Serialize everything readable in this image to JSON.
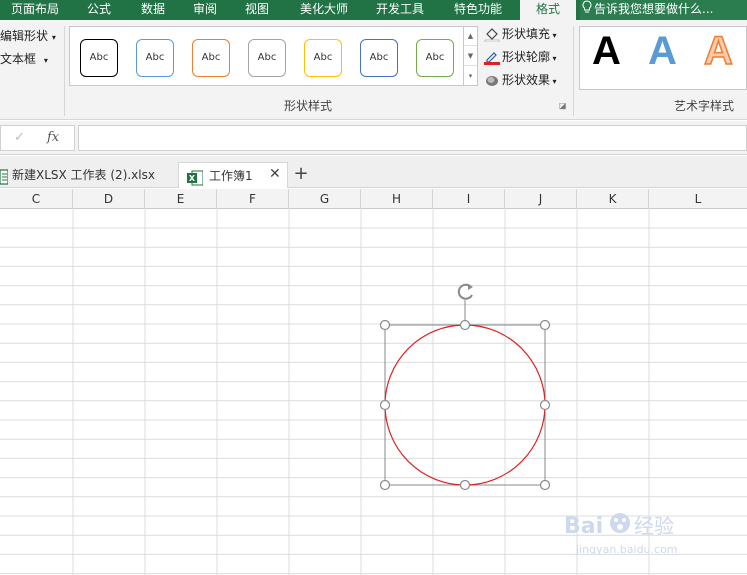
{
  "ribbon_tabs": [
    {
      "label": "页面布局",
      "active": false
    },
    {
      "label": "公式",
      "active": false
    },
    {
      "label": "数据",
      "active": false
    },
    {
      "label": "审阅",
      "active": false
    },
    {
      "label": "视图",
      "active": false
    },
    {
      "label": "美化大师",
      "active": false
    },
    {
      "label": "开发工具",
      "active": false
    },
    {
      "label": "特色功能",
      "active": false
    },
    {
      "label": "格式",
      "active": true
    }
  ],
  "tell_me": {
    "text": "告诉我您想要做什么..."
  },
  "left_group": {
    "edit_shape": "编辑形状",
    "text_box": "文本框"
  },
  "shape_styles": {
    "swatch_label": "Abc",
    "swatch_colors": [
      "#000000",
      "#5b9bd5",
      "#ed7d31",
      "#a5a5a5",
      "#ffc000",
      "#4472c4",
      "#70ad47"
    ],
    "fill": "形状填充",
    "outline": "形状轮廓",
    "effects": "形状效果",
    "group_label": "形状样式"
  },
  "wordart": {
    "letter": "A",
    "group_label": "艺术字样式"
  },
  "formula_bar": {
    "value": ""
  },
  "workbook_tabs": [
    {
      "label": "新建XLSX 工作表 (2).xlsx",
      "active": false
    },
    {
      "label": "工作簿1",
      "active": true
    }
  ],
  "columns": [
    "C",
    "D",
    "E",
    "F",
    "G",
    "H",
    "I",
    "J",
    "K",
    "L"
  ],
  "shape": {
    "type": "circle",
    "outline_color": "#e02020",
    "selected": true
  },
  "watermark": {
    "brand": "Bai 经验",
    "url": "jingyan.baidu.com"
  },
  "colors": {
    "accent": "#217346",
    "outline_red": "#e02020"
  }
}
